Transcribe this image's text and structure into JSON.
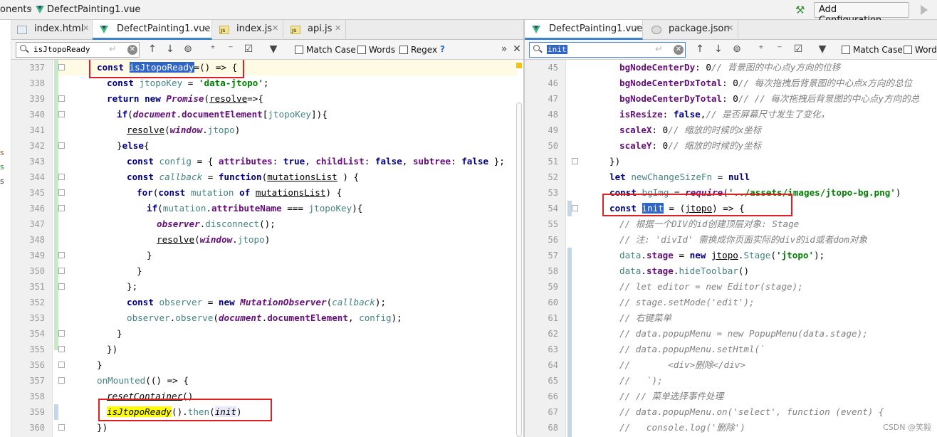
{
  "topbar": {
    "breadcrumb": [
      "onents",
      "DefectPainting1.vue"
    ],
    "add_configuration": "Add Configuration..."
  },
  "left_strip": [
    "s",
    "s",
    "s"
  ],
  "left_pane": {
    "tabs": [
      {
        "label": "index.html",
        "icon": "html-file-icon",
        "active": false
      },
      {
        "label": "DefectPainting1.vue",
        "icon": "vue-file-icon",
        "active": true
      },
      {
        "label": "index.js",
        "icon": "js-file-icon",
        "active": false
      },
      {
        "label": "api.js",
        "icon": "js-file-icon",
        "active": false
      }
    ],
    "search": {
      "value": "isJtopoReady",
      "options": [
        "Match Case",
        "Words",
        "Regex"
      ],
      "help": "?"
    },
    "line_numbers": [
      "337",
      "338",
      "339",
      "340",
      "341",
      "342",
      "343",
      "344",
      "345",
      "346",
      "347",
      "348",
      "349",
      "350",
      "351",
      "352",
      "353",
      "354",
      "355",
      "356",
      "357",
      "358",
      "359",
      "360"
    ]
  },
  "right_pane": {
    "tabs": [
      {
        "label": "DefectPainting1.vue",
        "icon": "vue-file-icon",
        "active": true
      },
      {
        "label": "package.json",
        "icon": "json-file-icon",
        "active": false
      }
    ],
    "search": {
      "value": "init",
      "options": [
        "Match Case",
        "Words"
      ]
    },
    "line_numbers": [
      "45",
      "46",
      "47",
      "48",
      "49",
      "50",
      "51",
      "52",
      "53",
      "54",
      "55",
      "56",
      "57",
      "58",
      "59",
      "60",
      "61",
      "62",
      "63",
      "64",
      "65",
      "66",
      "67",
      "68"
    ]
  },
  "code_left": [
    {
      "segs": [
        [
          "kw",
          "const "
        ],
        [
          "hl-sel",
          "isJtopoReady"
        ],
        [
          "",
          "=() => {"
        ]
      ]
    },
    {
      "segs": [
        [
          "kw",
          "const "
        ],
        [
          "var",
          "jtopoKey"
        ],
        [
          "",
          " = "
        ],
        [
          "str",
          "'data-jtopo'"
        ],
        [
          "",
          ";"
        ]
      ]
    },
    {
      "segs": [
        [
          "kw",
          "return new "
        ],
        [
          "glob",
          "Promise"
        ],
        [
          "",
          "("
        ],
        [
          "ul",
          "resolve"
        ],
        [
          "",
          "=>{"
        ]
      ]
    },
    {
      "segs": [
        [
          "kw",
          "if"
        ],
        [
          "",
          "("
        ],
        [
          "glob",
          "document"
        ],
        [
          "",
          "."
        ],
        [
          "fld",
          "documentElement"
        ],
        [
          "",
          "["
        ],
        [
          "var",
          "jtopoKey"
        ],
        [
          "",
          "]){"
        ]
      ]
    },
    {
      "segs": [
        [
          "ul",
          "resolve"
        ],
        [
          "",
          "("
        ],
        [
          "glob",
          "window"
        ],
        [
          "",
          "."
        ],
        [
          "var",
          "jtopo"
        ],
        [
          "",
          ")"
        ]
      ]
    },
    {
      "segs": [
        [
          "",
          "}"
        ],
        [
          "kw",
          "else"
        ],
        [
          "",
          "{"
        ]
      ]
    },
    {
      "segs": [
        [
          "kw",
          "const "
        ],
        [
          "var",
          "config"
        ],
        [
          "",
          " = { "
        ],
        [
          "fld",
          "attributes"
        ],
        [
          "",
          ": "
        ],
        [
          "kw",
          "true"
        ],
        [
          "",
          ", "
        ],
        [
          "fld",
          "childList"
        ],
        [
          "",
          ": "
        ],
        [
          "kw",
          "false"
        ],
        [
          "",
          ", "
        ],
        [
          "fld",
          "subtree"
        ],
        [
          "",
          ": "
        ],
        [
          "kw",
          "false"
        ],
        [
          "",
          " };"
        ]
      ]
    },
    {
      "segs": [
        [
          "kw",
          "const "
        ],
        [
          "var itf",
          "callback"
        ],
        [
          "",
          " = "
        ],
        [
          "kw",
          "function"
        ],
        [
          "",
          "("
        ],
        [
          "ul",
          "mutationsList"
        ],
        [
          "",
          " ) {"
        ]
      ]
    },
    {
      "segs": [
        [
          "kw",
          "for"
        ],
        [
          "",
          "("
        ],
        [
          "kw",
          "const "
        ],
        [
          "var",
          "mutation"
        ],
        [
          "",
          " "
        ],
        [
          "kw",
          "of "
        ],
        [
          "ul",
          "mutationsList"
        ],
        [
          "",
          ") {"
        ]
      ]
    },
    {
      "segs": [
        [
          "kw",
          "if"
        ],
        [
          "",
          "("
        ],
        [
          "var",
          "mutation"
        ],
        [
          "",
          "."
        ],
        [
          "fld",
          "attributeName"
        ],
        [
          "",
          " === "
        ],
        [
          "var",
          "jtopoKey"
        ],
        [
          "",
          "){"
        ]
      ]
    },
    {
      "segs": [
        [
          "glob",
          "observer"
        ],
        [
          "",
          "."
        ],
        [
          "var",
          "disconnect"
        ],
        [
          "",
          "();"
        ]
      ]
    },
    {
      "segs": [
        [
          "ul",
          "resolve"
        ],
        [
          "",
          "("
        ],
        [
          "glob",
          "window"
        ],
        [
          "",
          "."
        ],
        [
          "var",
          "jtopo"
        ],
        [
          "",
          ")"
        ]
      ]
    },
    {
      "segs": [
        [
          "",
          "}"
        ]
      ]
    },
    {
      "segs": [
        [
          "",
          "}"
        ]
      ]
    },
    {
      "segs": [
        [
          "",
          "};"
        ]
      ]
    },
    {
      "segs": [
        [
          "kw",
          "const "
        ],
        [
          "var",
          "observer"
        ],
        [
          "",
          " = "
        ],
        [
          "kw",
          "new "
        ],
        [
          "glob",
          "MutationObserver"
        ],
        [
          "",
          "("
        ],
        [
          "var itf",
          "callback"
        ],
        [
          "",
          ");"
        ]
      ]
    },
    {
      "segs": [
        [
          "var",
          "observer"
        ],
        [
          "",
          "."
        ],
        [
          "var",
          "observe"
        ],
        [
          "",
          "("
        ],
        [
          "glob",
          "document"
        ],
        [
          "",
          "."
        ],
        [
          "fld",
          "documentElement"
        ],
        [
          "",
          ", "
        ],
        [
          "var",
          "config"
        ],
        [
          "",
          ");"
        ]
      ]
    },
    {
      "segs": [
        [
          "",
          "}"
        ]
      ]
    },
    {
      "segs": [
        [
          "",
          "})"
        ]
      ]
    },
    {
      "segs": [
        [
          "",
          "}"
        ]
      ]
    },
    {
      "segs": [
        [
          "var",
          "onMounted"
        ],
        [
          "",
          "(() => {"
        ]
      ]
    },
    {
      "segs": [
        [
          "itf ul",
          "resetContainer"
        ],
        [
          "",
          "()"
        ]
      ]
    },
    {
      "segs": [
        [
          "hl-y itf",
          "isJtopoReady"
        ],
        [
          "",
          "()."
        ],
        [
          "var",
          "then"
        ],
        [
          "",
          "("
        ],
        [
          "hl-u itf",
          "init"
        ],
        [
          "",
          ")"
        ]
      ]
    },
    {
      "segs": [
        [
          "",
          "})"
        ]
      ]
    }
  ],
  "code_right": [
    {
      "segs": [
        [
          "fld",
          "bgNodeCenterDy"
        ],
        [
          "",
          ": "
        ],
        [
          "",
          "0"
        ],
        [
          "cm",
          "// 背景图的中心点y方向的位移"
        ]
      ]
    },
    {
      "segs": [
        [
          "fld",
          "bgNodeCenterDxTotal"
        ],
        [
          "",
          ": "
        ],
        [
          "",
          "0"
        ],
        [
          "cm",
          "// 每次拖拽后背景图的中心点x方向的总位"
        ]
      ]
    },
    {
      "segs": [
        [
          "fld",
          "bgNodeCenterDyTotal"
        ],
        [
          "",
          ": "
        ],
        [
          "",
          "0"
        ],
        [
          "cm",
          "// // 每次拖拽后背景图的中心点y方向的总"
        ]
      ]
    },
    {
      "segs": [
        [
          "fld",
          "isResize"
        ],
        [
          "",
          ": "
        ],
        [
          "kw",
          "false"
        ],
        [
          "",
          ","
        ],
        [
          "cm",
          "// 是否屏幕尺寸发生了变化，"
        ]
      ]
    },
    {
      "segs": [
        [
          "fld",
          "scaleX"
        ],
        [
          "",
          ": "
        ],
        [
          "",
          "0"
        ],
        [
          "cm",
          "// 缩放的时候的x坐标"
        ]
      ]
    },
    {
      "segs": [
        [
          "fld",
          "scaleY"
        ],
        [
          "",
          ": "
        ],
        [
          "",
          "0"
        ],
        [
          "cm",
          "// 缩放的时候的y坐标"
        ]
      ]
    },
    {
      "segs": [
        [
          "",
          "})"
        ]
      ]
    },
    {
      "segs": [
        [
          "kw",
          "let "
        ],
        [
          "var",
          "newChangeSizeFn"
        ],
        [
          "",
          " = "
        ],
        [
          "kw",
          "null"
        ]
      ]
    },
    {
      "segs": [
        [
          "kw",
          "const "
        ],
        [
          "var",
          "bgImg"
        ],
        [
          "",
          " = "
        ],
        [
          "glob",
          "require"
        ],
        [
          "",
          "("
        ],
        [
          "str",
          "'../assets/images/jtopo-bg.png'"
        ],
        [
          "",
          ")"
        ]
      ]
    },
    {
      "segs": [
        [
          "kw",
          "const "
        ],
        [
          "hl-sel",
          "init"
        ],
        [
          "",
          " = ("
        ],
        [
          "ul",
          "jtopo"
        ],
        [
          "",
          ") => {"
        ]
      ]
    },
    {
      "segs": [
        [
          "cm",
          "// 根据一个DIV的id创建顶层对象: Stage"
        ]
      ]
    },
    {
      "segs": [
        [
          "cm",
          "// 注: 'divId' 需换成你页面实际的div的id或者dom对象"
        ]
      ]
    },
    {
      "segs": [
        [
          "var",
          "data"
        ],
        [
          "",
          "."
        ],
        [
          "fld",
          "stage"
        ],
        [
          "",
          " = "
        ],
        [
          "kw",
          "new "
        ],
        [
          "ul",
          "jtopo"
        ],
        [
          "",
          "."
        ],
        [
          "var",
          "Stage"
        ],
        [
          "",
          "("
        ],
        [
          "str",
          "'jtopo'"
        ],
        [
          "",
          ");"
        ]
      ]
    },
    {
      "segs": [
        [
          "var",
          "data"
        ],
        [
          "",
          "."
        ],
        [
          "fld",
          "stage"
        ],
        [
          "",
          "."
        ],
        [
          "var",
          "hideToolbar"
        ],
        [
          "",
          "()"
        ]
      ]
    },
    {
      "segs": [
        [
          "cm",
          "// let editor = new Editor(stage);"
        ]
      ]
    },
    {
      "segs": [
        [
          "cm",
          "// stage.setMode('edit');"
        ]
      ]
    },
    {
      "segs": [
        [
          "cm",
          "// 右键菜单"
        ]
      ]
    },
    {
      "segs": [
        [
          "cm",
          "// data.popupMenu = new PopupMenu(data.stage);"
        ]
      ]
    },
    {
      "segs": [
        [
          "cm",
          "// data.popupMenu.setHtml(`"
        ]
      ]
    },
    {
      "segs": [
        [
          "cm",
          "//       <div>删除</div>"
        ]
      ]
    },
    {
      "segs": [
        [
          "cm",
          "//   `);"
        ]
      ]
    },
    {
      "segs": [
        [
          "cm",
          "// // 菜单选择事件处理"
        ]
      ]
    },
    {
      "segs": [
        [
          "cm",
          "// data.popupMenu.on('select', function (event) {"
        ]
      ]
    },
    {
      "segs": [
        [
          "cm",
          "//   console.log('删除')"
        ]
      ]
    }
  ],
  "watermark": "CSDN @笑毅"
}
